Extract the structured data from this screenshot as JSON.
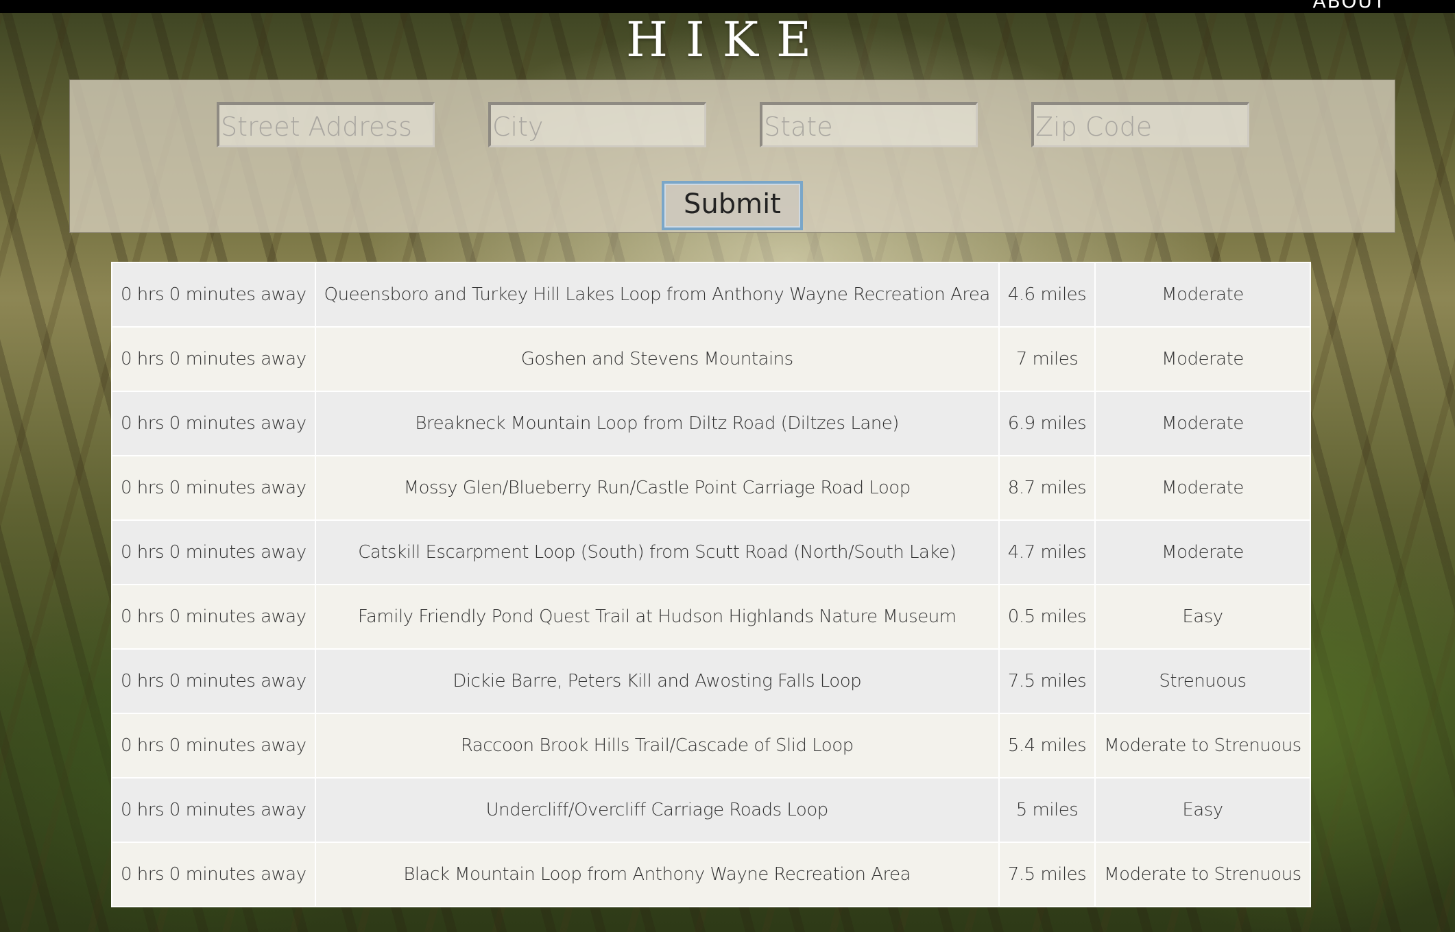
{
  "nav": {
    "about": "ABOUT"
  },
  "header": {
    "title": "HIKE"
  },
  "form": {
    "street_placeholder": "Street Address",
    "city_placeholder": "City",
    "state_placeholder": "State",
    "zip_placeholder": "Zip Code",
    "submit_label": "Submit"
  },
  "trails": [
    {
      "away": "0 hrs 0 minutes away",
      "name": "Queensboro and Turkey Hill Lakes Loop from Anthony Wayne Recreation Area",
      "distance": "4.6 miles",
      "difficulty": "Moderate"
    },
    {
      "away": "0 hrs 0 minutes away",
      "name": "Goshen and Stevens Mountains",
      "distance": "7 miles",
      "difficulty": "Moderate"
    },
    {
      "away": "0 hrs 0 minutes away",
      "name": "Breakneck Mountain Loop from Diltz Road (Diltzes Lane)",
      "distance": "6.9 miles",
      "difficulty": "Moderate"
    },
    {
      "away": "0 hrs 0 minutes away",
      "name": "Mossy Glen/Blueberry Run/Castle Point Carriage Road Loop",
      "distance": "8.7 miles",
      "difficulty": "Moderate"
    },
    {
      "away": "0 hrs 0 minutes away",
      "name": "Catskill Escarpment Loop (South) from Scutt Road (North/South Lake)",
      "distance": "4.7 miles",
      "difficulty": "Moderate"
    },
    {
      "away": "0 hrs 0 minutes away",
      "name": "Family Friendly Pond Quest Trail at Hudson Highlands Nature Museum",
      "distance": "0.5 miles",
      "difficulty": "Easy"
    },
    {
      "away": "0 hrs 0 minutes away",
      "name": "Dickie Barre, Peters Kill and Awosting Falls Loop",
      "distance": "7.5 miles",
      "difficulty": "Strenuous"
    },
    {
      "away": "0 hrs 0 minutes away",
      "name": "Raccoon Brook Hills Trail/Cascade of Slid Loop",
      "distance": "5.4 miles",
      "difficulty": "Moderate to Strenuous"
    },
    {
      "away": "0 hrs 0 minutes away",
      "name": "Undercliff/Overcliff Carriage Roads Loop",
      "distance": "5 miles",
      "difficulty": "Easy"
    },
    {
      "away": "0 hrs 0 minutes away",
      "name": "Black Mountain Loop from Anthony Wayne Recreation Area",
      "distance": "7.5 miles",
      "difficulty": "Moderate to Strenuous"
    }
  ]
}
